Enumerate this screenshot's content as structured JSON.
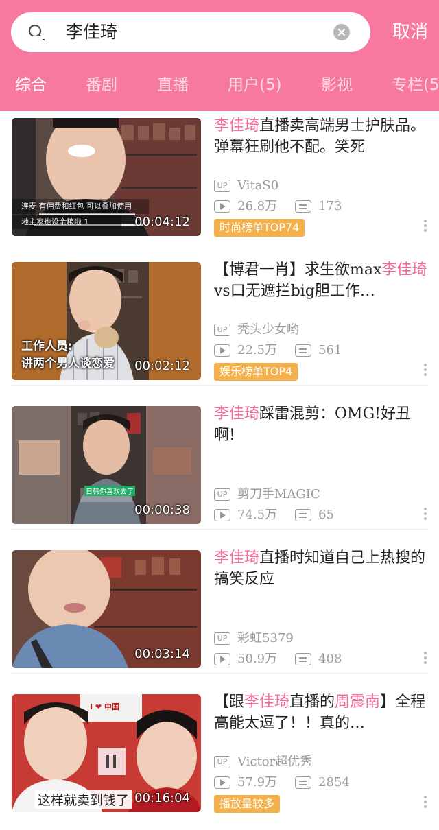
{
  "search": {
    "query": "李佳琦",
    "cancel_label": "取消"
  },
  "tabs": [
    "综合",
    "番剧",
    "直播",
    "用户(5)",
    "影视",
    "专栏(5"
  ],
  "videos": [
    {
      "title_parts": [
        [
          "李佳琦",
          true
        ],
        [
          "直播卖高端男士护肤品。弹幕狂刷他不配。笑死",
          false
        ]
      ],
      "duration": "00:04:12",
      "uploader": "VitaS0",
      "views": "26.8万",
      "comments": "173",
      "rank": "时尚榜单TOP74",
      "thumb_caption": "连麦 有佣费和红包 可以叠加使用",
      "thumb_caption2": "地主家也没余粮啦 1"
    },
    {
      "title_parts": [
        [
          "【博君一肖】求生欲max",
          false
        ],
        [
          "李佳琦",
          true
        ],
        [
          "vs口无遮拦big胆工作…",
          false
        ]
      ],
      "duration": "00:02:12",
      "uploader": "秃头少女哟",
      "views": "22.5万",
      "comments": "561",
      "rank": "娱乐榜单TOP4",
      "thumb_caption": "工作人员:",
      "thumb_caption2": "讲两个男人谈恋爱"
    },
    {
      "title_parts": [
        [
          "李佳琦",
          true
        ],
        [
          "踩雷混剪：OMG!好丑啊!",
          false
        ]
      ],
      "duration": "00:00:38",
      "uploader": "剪刀手MAGIC",
      "views": "74.5万",
      "comments": "65",
      "rank": "",
      "thumb_caption": "日韩你喜欢去了"
    },
    {
      "title_parts": [
        [
          "李佳琦",
          true
        ],
        [
          "直播时知道自己上热搜的搞笑反应",
          false
        ]
      ],
      "duration": "00:03:14",
      "uploader": "彩虹5379",
      "views": "50.9万",
      "comments": "408",
      "rank": ""
    },
    {
      "title_parts": [
        [
          "【跟",
          false
        ],
        [
          "李佳琦",
          true
        ],
        [
          "直播的",
          false
        ],
        [
          "周震南",
          true
        ],
        [
          "】全程高能太逗了！！真的…",
          false
        ]
      ],
      "duration": "00:16:04",
      "uploader": "Victor超优秀",
      "views": "57.9万",
      "comments": "2854",
      "rank": "播放量较多",
      "thumb_caption": "这样就卖到钱了",
      "thumb_sign": "I ❤ 中国"
    }
  ],
  "colors": {
    "header": "#f8799e",
    "highlight": "#f16c98",
    "rank_badge": "#f4b04a"
  },
  "icons": {
    "search": "search-icon",
    "clear": "clear-icon",
    "more": "more-vertical-icon",
    "play": "play-count-icon",
    "danmaku": "danmaku-count-icon",
    "up": "uploader-badge-icon"
  }
}
